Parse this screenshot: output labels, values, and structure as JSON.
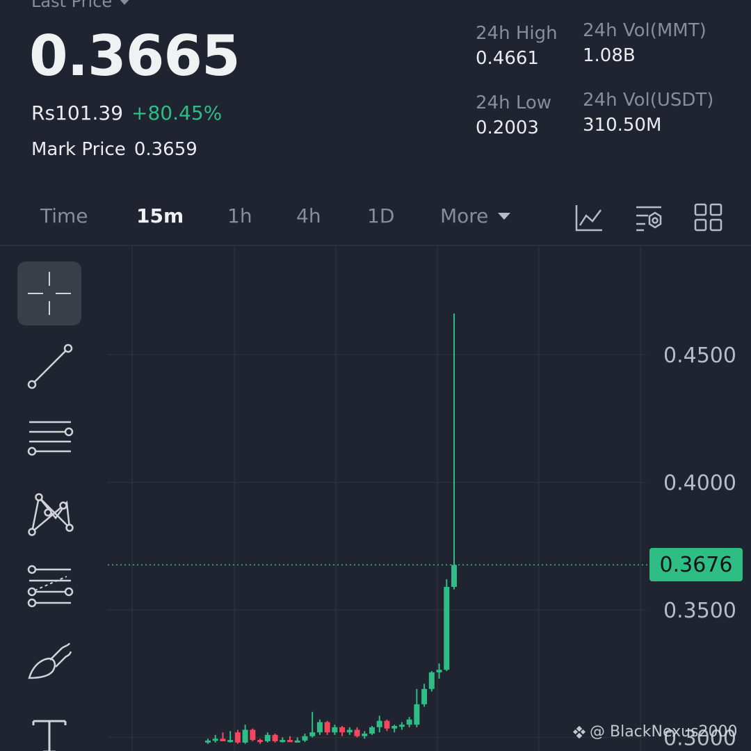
{
  "header": {
    "last_price_label": "Last Price",
    "last_price": "0.3665",
    "fiat_price": "Rs101.39",
    "change_pct": "+80.45%",
    "mark_price_label": "Mark Price",
    "mark_price": "0.3659"
  },
  "stats": {
    "high_label": "24h High",
    "high_value": "0.4661",
    "low_label": "24h Low",
    "low_value": "0.2003",
    "vol_base_label": "24h Vol(MMT)",
    "vol_base_value": "1.08B",
    "vol_quote_label": "24h Vol(USDT)",
    "vol_quote_value": "310.50M"
  },
  "tabs": {
    "items": [
      {
        "label": "Time",
        "active": false
      },
      {
        "label": "15m",
        "active": true
      },
      {
        "label": "1h",
        "active": false
      },
      {
        "label": "4h",
        "active": false
      },
      {
        "label": "1D",
        "active": false
      },
      {
        "label": "More",
        "active": false
      }
    ],
    "icons": [
      "indicator-chart-icon",
      "chart-settings-icon",
      "layout-grid-icon"
    ]
  },
  "draw_tools": [
    {
      "icon": "crosshair-icon",
      "selected": true
    },
    {
      "icon": "trend-line-icon",
      "selected": false
    },
    {
      "icon": "horizontal-lines-icon",
      "selected": false
    },
    {
      "icon": "pattern-icon",
      "selected": false
    },
    {
      "icon": "fibonacci-icon",
      "selected": false
    },
    {
      "icon": "brush-icon",
      "selected": false
    },
    {
      "icon": "text-tool-icon",
      "selected": false
    }
  ],
  "chart": {
    "y_ticks": [
      "0.4500",
      "0.4000",
      "0.3500",
      "0.3000"
    ],
    "current_price": "0.3676",
    "up_color": "#2ebd85",
    "down_color": "#f6465d",
    "watermark": "@ BlackNexus2000",
    "candles": [
      {
        "o": 0.2985,
        "h": 0.2995,
        "l": 0.2975,
        "c": 0.2988
      },
      {
        "o": 0.299,
        "h": 0.301,
        "l": 0.298,
        "c": 0.2995
      },
      {
        "o": 0.2995,
        "h": 0.302,
        "l": 0.2985,
        "c": 0.2985
      },
      {
        "o": 0.2985,
        "h": 0.3025,
        "l": 0.298,
        "c": 0.299
      },
      {
        "o": 0.302,
        "h": 0.303,
        "l": 0.2975,
        "c": 0.298
      },
      {
        "o": 0.298,
        "h": 0.305,
        "l": 0.2975,
        "c": 0.303
      },
      {
        "o": 0.303,
        "h": 0.3035,
        "l": 0.2985,
        "c": 0.299
      },
      {
        "o": 0.299,
        "h": 0.2995,
        "l": 0.2975,
        "c": 0.2985
      },
      {
        "o": 0.2985,
        "h": 0.302,
        "l": 0.298,
        "c": 0.301
      },
      {
        "o": 0.301,
        "h": 0.3015,
        "l": 0.298,
        "c": 0.2985
      },
      {
        "o": 0.2985,
        "h": 0.3,
        "l": 0.298,
        "c": 0.299
      },
      {
        "o": 0.299,
        "h": 0.3005,
        "l": 0.2982,
        "c": 0.2985
      },
      {
        "o": 0.2985,
        "h": 0.3,
        "l": 0.298,
        "c": 0.2988
      },
      {
        "o": 0.2988,
        "h": 0.3015,
        "l": 0.2982,
        "c": 0.3005
      },
      {
        "o": 0.3005,
        "h": 0.31,
        "l": 0.3,
        "c": 0.302
      },
      {
        "o": 0.302,
        "h": 0.307,
        "l": 0.301,
        "c": 0.306
      },
      {
        "o": 0.306,
        "h": 0.3065,
        "l": 0.301,
        "c": 0.302
      },
      {
        "o": 0.302,
        "h": 0.305,
        "l": 0.301,
        "c": 0.304
      },
      {
        "o": 0.304,
        "h": 0.3045,
        "l": 0.3005,
        "c": 0.302
      },
      {
        "o": 0.302,
        "h": 0.304,
        "l": 0.301,
        "c": 0.303
      },
      {
        "o": 0.303,
        "h": 0.304,
        "l": 0.3,
        "c": 0.3005
      },
      {
        "o": 0.3005,
        "h": 0.3025,
        "l": 0.2995,
        "c": 0.3015
      },
      {
        "o": 0.3015,
        "h": 0.3045,
        "l": 0.301,
        "c": 0.304
      },
      {
        "o": 0.304,
        "h": 0.3085,
        "l": 0.302,
        "c": 0.3065
      },
      {
        "o": 0.3065,
        "h": 0.307,
        "l": 0.3025,
        "c": 0.3035
      },
      {
        "o": 0.3035,
        "h": 0.305,
        "l": 0.302,
        "c": 0.3045
      },
      {
        "o": 0.3045,
        "h": 0.306,
        "l": 0.303,
        "c": 0.305
      },
      {
        "o": 0.305,
        "h": 0.308,
        "l": 0.304,
        "c": 0.307
      },
      {
        "o": 0.305,
        "h": 0.319,
        "l": 0.304,
        "c": 0.313
      },
      {
        "o": 0.313,
        "h": 0.321,
        "l": 0.312,
        "c": 0.319
      },
      {
        "o": 0.319,
        "h": 0.326,
        "l": 0.318,
        "c": 0.3255
      },
      {
        "o": 0.3255,
        "h": 0.329,
        "l": 0.323,
        "c": 0.3265
      },
      {
        "o": 0.3265,
        "h": 0.362,
        "l": 0.326,
        "c": 0.359
      },
      {
        "o": 0.359,
        "h": 0.4661,
        "l": 0.358,
        "c": 0.3676
      }
    ]
  }
}
